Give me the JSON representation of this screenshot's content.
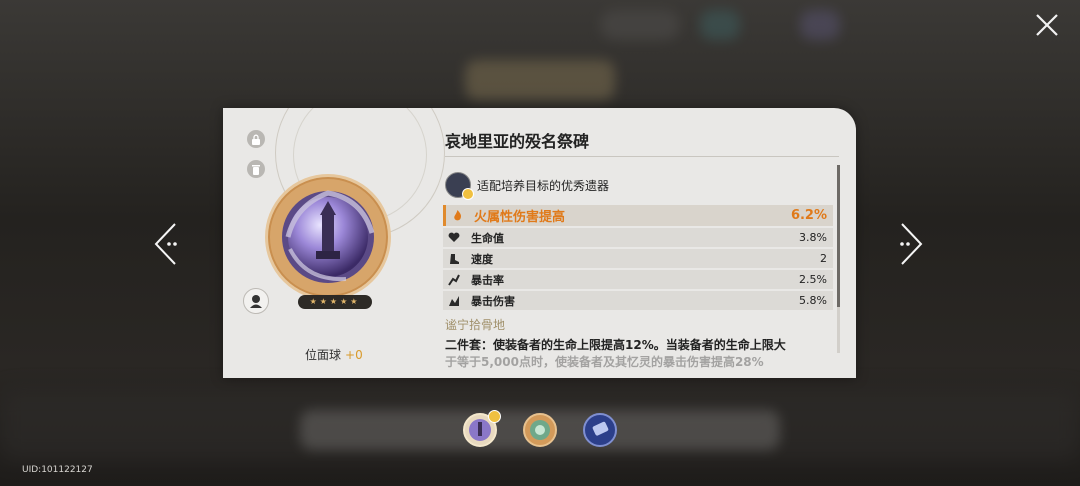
{
  "relic": {
    "name": "哀地里亚的殁名祭碑",
    "slot_label": "位面球",
    "level": "+0",
    "stars": "★★★★★"
  },
  "recommend": {
    "text": "适配培养目标的优秀遗器"
  },
  "stats": {
    "main": {
      "name": "火属性伤害提高",
      "value": "6.2%",
      "icon": "fire-damage-icon"
    },
    "subs": [
      {
        "name": "生命值",
        "value": "3.8%",
        "icon": "heart-hp-icon"
      },
      {
        "name": "速度",
        "value": "2",
        "icon": "boot-speed-icon"
      },
      {
        "name": "暴击率",
        "value": "2.5%",
        "icon": "crit-rate-icon"
      },
      {
        "name": "暴击伤害",
        "value": "5.8%",
        "icon": "crit-damage-icon"
      }
    ]
  },
  "set": {
    "name": "谧宁拾骨地",
    "desc": "二件套：使装备者的生命上限提高12%。当装备者的生命上限大",
    "desc_cont": "于等于5,000点时，使装备者及其忆灵的暴击伤害提高28%"
  },
  "footer": {
    "uid": "UID:101122127"
  },
  "colors": {
    "accent": "#e07a1a",
    "set_name": "#a0906a",
    "card_bg": "#e9e8e6"
  }
}
